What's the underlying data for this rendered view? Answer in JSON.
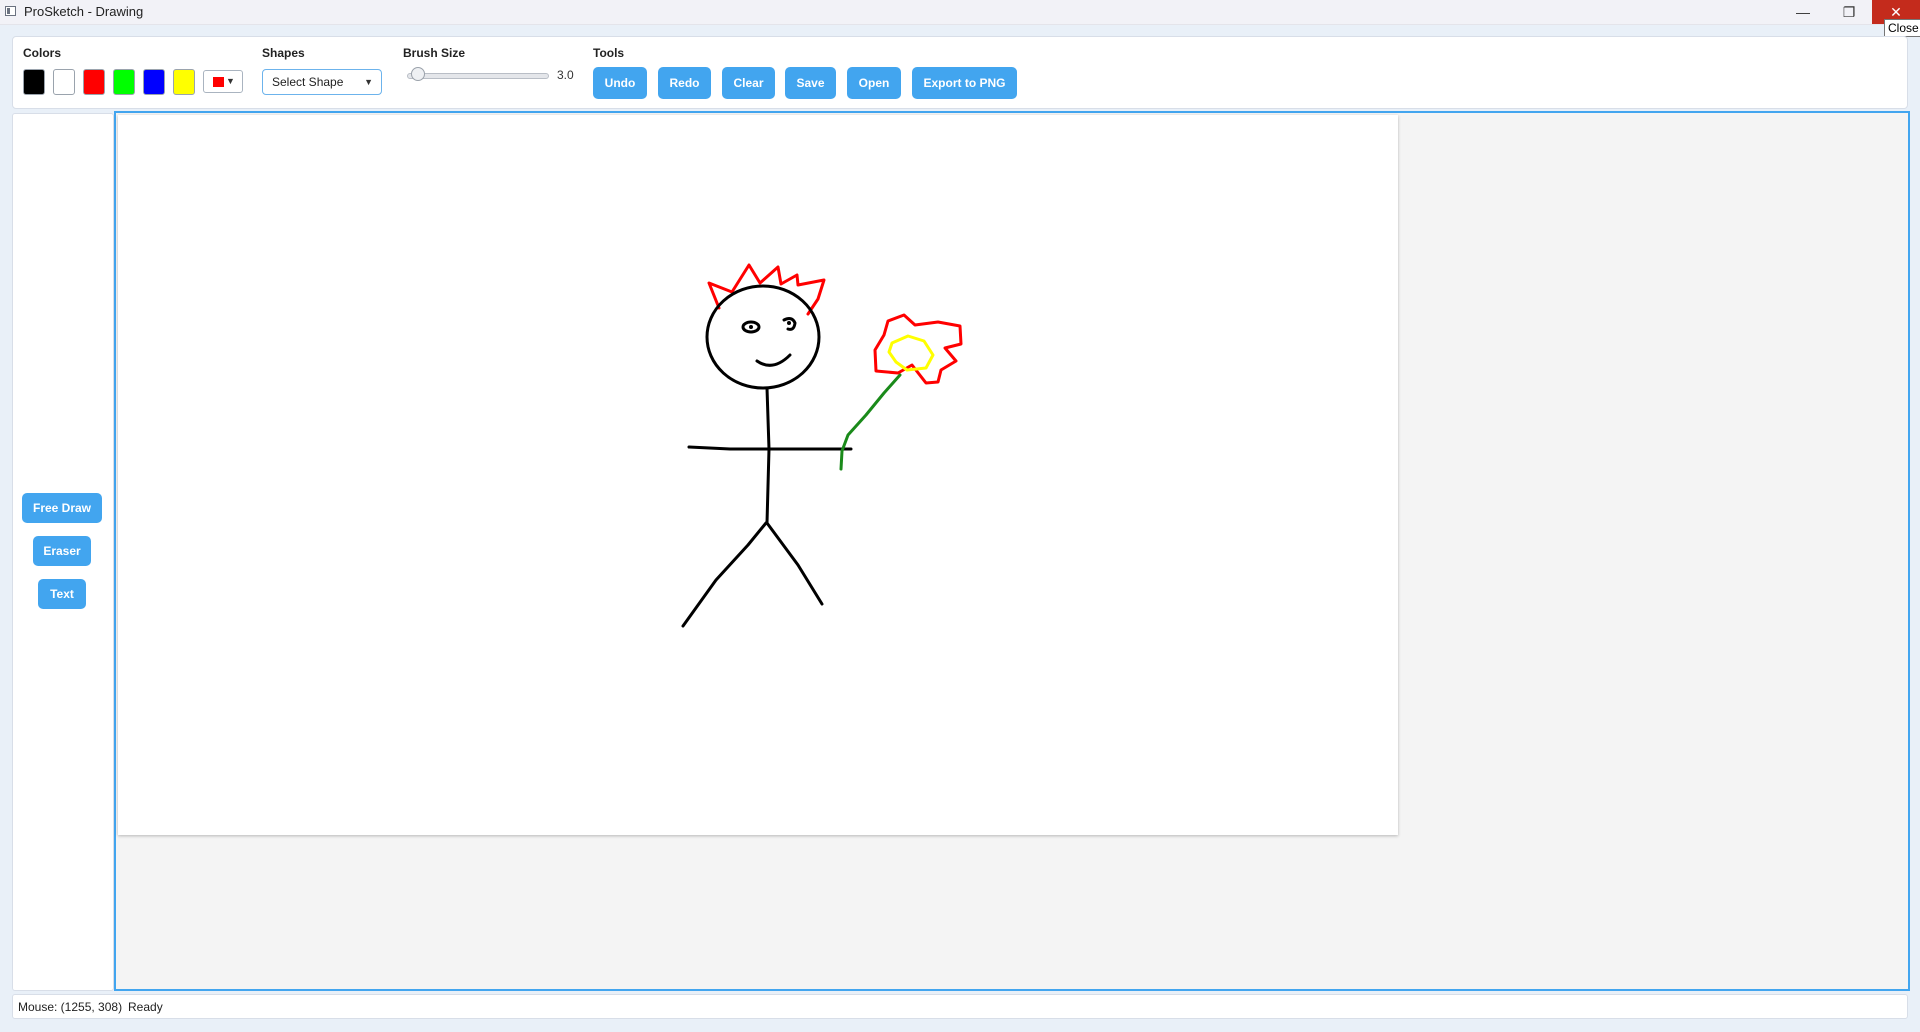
{
  "window": {
    "title": "ProSketch - Drawing",
    "close_tooltip": "Close",
    "minimize_glyph": "—",
    "maximize_glyph": "❐",
    "close_glyph": "✕"
  },
  "toolbar": {
    "colors_label": "Colors",
    "swatches": [
      {
        "name": "black",
        "color": "#000000"
      },
      {
        "name": "white",
        "color": "#ffffff"
      },
      {
        "name": "red",
        "color": "#ff0000"
      },
      {
        "name": "green",
        "color": "#00ff00"
      },
      {
        "name": "blue",
        "color": "#0000ff"
      },
      {
        "name": "yellow",
        "color": "#ffff00"
      }
    ],
    "current_color": "#ff0000",
    "shapes_label": "Shapes",
    "shape_select_value": "Select Shape",
    "brush_label": "Brush Size",
    "brush_value": "3.0",
    "brush_fraction": 0.08,
    "tools_label": "Tools",
    "buttons": {
      "undo": "Undo",
      "redo": "Redo",
      "clear": "Clear",
      "save": "Save",
      "open": "Open",
      "export": "Export to PNG"
    }
  },
  "sidebar": {
    "free_draw": "Free Draw",
    "eraser": "Eraser",
    "text": "Text"
  },
  "drawing": {
    "description_strokes": [
      "hair",
      "head",
      "eye-left",
      "eye-right",
      "mouth",
      "body",
      "arms",
      "legs",
      "flower-petals",
      "flower-center",
      "flower-stem"
    ],
    "stroke_colors": {
      "figure": "#000000",
      "hair": "#ff0000",
      "petals": "#ff0000",
      "center": "#ffff00",
      "stem": "#008000"
    }
  },
  "status": {
    "mouse": "Mouse: (1255, 308)",
    "text": "Ready"
  },
  "accent_color": "#42a5ef"
}
